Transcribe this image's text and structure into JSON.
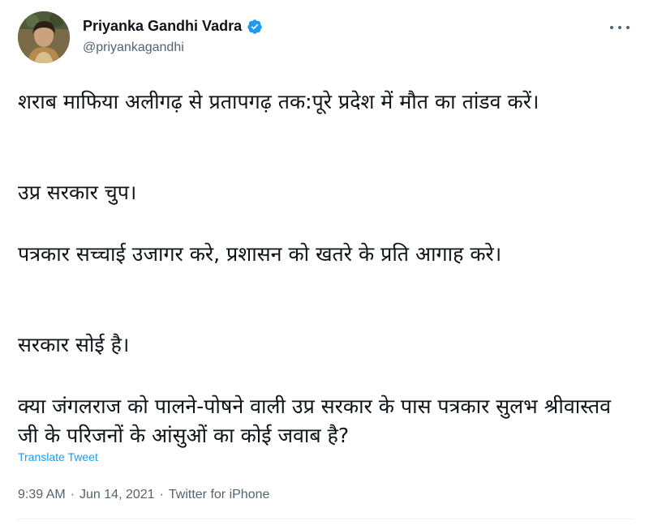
{
  "author": {
    "display_name": "Priyanka Gandhi Vadra",
    "handle": "@priyankagandhi",
    "verified": true,
    "verified_color": "#1d9bf0"
  },
  "icons": {
    "verified": "verified-badge-icon",
    "more": "more-options-icon",
    "avatar": "profile-avatar"
  },
  "tweet": {
    "paragraphs": [
      "शराब माफिया अलीगढ़ से प्रतापगढ़ तक:पूरे प्रदेश में मौत का तांडव करें।",
      "उप्र सरकार चुप।",
      "पत्रकार सच्चाई उजागर करे, प्रशासन को खतरे के प्रति आगाह करे।",
      "सरकार सोई है।",
      "क्या जंगलराज को पालने-पोषने वाली उप्र सरकार के पास पत्रकार सुलभ श्रीवास्तव जी के परिजनों के आंसुओं का कोई जवाब है?"
    ],
    "translate_label": "Translate Tweet",
    "time": "9:39 AM",
    "separator": "·",
    "date": "Jun 14, 2021",
    "source": "Twitter for iPhone"
  },
  "colors": {
    "link": "#1d9bf0",
    "secondary_text": "#536471",
    "primary_text": "#0f1419"
  }
}
